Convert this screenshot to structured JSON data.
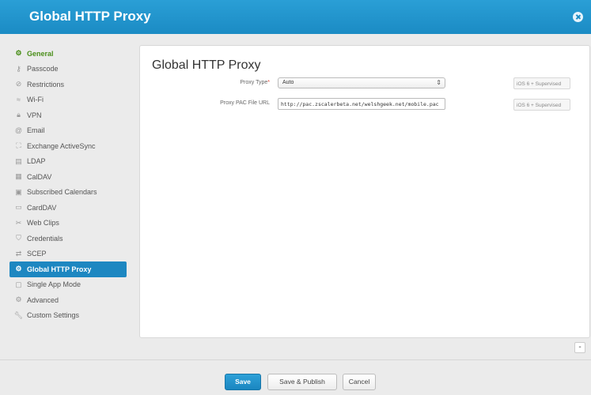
{
  "window": {
    "title": "Global HTTP Proxy"
  },
  "sidebar": {
    "items": [
      {
        "label": "General",
        "icon": "gear-icon",
        "state": "green"
      },
      {
        "label": "Passcode",
        "icon": "key-icon"
      },
      {
        "label": "Restrictions",
        "icon": "restriction-icon"
      },
      {
        "label": "Wi-Fi",
        "icon": "wifi-icon"
      },
      {
        "label": "VPN",
        "icon": "lock-icon"
      },
      {
        "label": "Email",
        "icon": "email-icon"
      },
      {
        "label": "Exchange ActiveSync",
        "icon": "exchange-icon"
      },
      {
        "label": "LDAP",
        "icon": "ldap-icon"
      },
      {
        "label": "CalDAV",
        "icon": "calendar-icon"
      },
      {
        "label": "Subscribed Calendars",
        "icon": "calendar-icon"
      },
      {
        "label": "CardDAV",
        "icon": "contact-card-icon"
      },
      {
        "label": "Web Clips",
        "icon": "scissors-icon"
      },
      {
        "label": "Credentials",
        "icon": "shield-icon"
      },
      {
        "label": "SCEP",
        "icon": "exchange-arrows-icon"
      },
      {
        "label": "Global HTTP Proxy",
        "icon": "gear-icon",
        "state": "active"
      },
      {
        "label": "Single App Mode",
        "icon": "app-icon"
      },
      {
        "label": "Advanced",
        "icon": "gear-icon"
      },
      {
        "label": "Custom Settings",
        "icon": "wrench-icon"
      }
    ]
  },
  "main": {
    "title": "Global HTTP Proxy",
    "proxy_type": {
      "label": "Proxy Type",
      "required_marker": "*",
      "value": "Auto",
      "badge": "iOS 6 + Supervised"
    },
    "proxy_pac_url": {
      "label": "Proxy PAC File URL",
      "value": "http://pac.zscalerbeta.net/welshgeek.net/mobile.pac",
      "badge": "iOS 6 + Supervised"
    },
    "remove_label": "-"
  },
  "footer": {
    "save_label": "Save",
    "publish_label": "Save & Publish",
    "cancel_label": "Cancel"
  },
  "colors": {
    "accent": "#1d87c1",
    "general_green": "#4a8e1a"
  }
}
